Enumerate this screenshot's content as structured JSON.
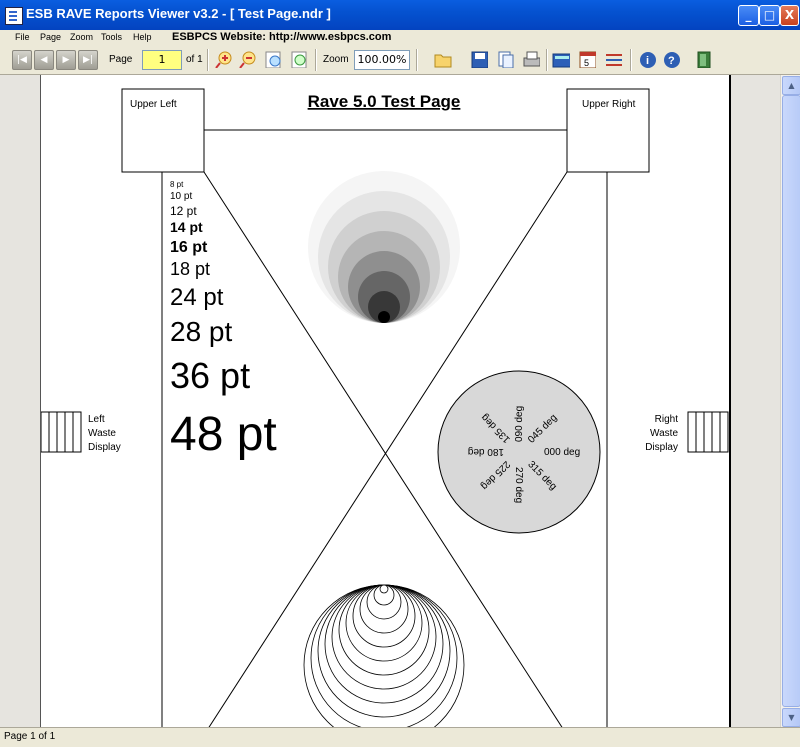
{
  "window": {
    "title": "ESB RAVE Reports Viewer v3.2 - [ Test Page.ndr ]",
    "minimize": "_",
    "maximize": "□",
    "close": "X"
  },
  "menu": {
    "items": [
      "File",
      "Page",
      "Zoom",
      "Tools",
      "Help"
    ],
    "website": "ESBPCS Website: http://www.esbpcs.com"
  },
  "toolbar": {
    "page_label": "Page",
    "page_value": "1",
    "page_of": "of 1",
    "zoom_label": "Zoom",
    "zoom_value": "100.00%",
    "icons": [
      "first-page-icon",
      "prev-page-icon",
      "next-page-icon",
      "last-page-icon",
      "zoom-in-icon",
      "zoom-out-icon",
      "zoom-page-icon",
      "zoom-width-icon",
      "open-icon",
      "save-icon",
      "copy-icon",
      "print-icon",
      "calculator-icon",
      "calendar-icon",
      "list-icon",
      "info-icon",
      "help-icon",
      "exit-icon"
    ]
  },
  "report": {
    "title": "Rave 5.0 Test Page",
    "upper_left": "Upper Left",
    "upper_right": "Upper Right",
    "left_waste": [
      "Left",
      "Waste",
      "Display"
    ],
    "right_waste": [
      "Right",
      "Waste",
      "Display"
    ],
    "font_samples": [
      "8 pt",
      "10 pt",
      "12 pt",
      "14 pt",
      "16 pt",
      "18 pt",
      "24 pt",
      "28 pt",
      "36 pt",
      "48 pt"
    ],
    "angle_labels": [
      "000 deg",
      "045 deg",
      "090 deg",
      "135 deg",
      "180 deg",
      "225 deg",
      "270 deg",
      "315 deg"
    ]
  },
  "status": {
    "text": "Page 1 of 1"
  }
}
